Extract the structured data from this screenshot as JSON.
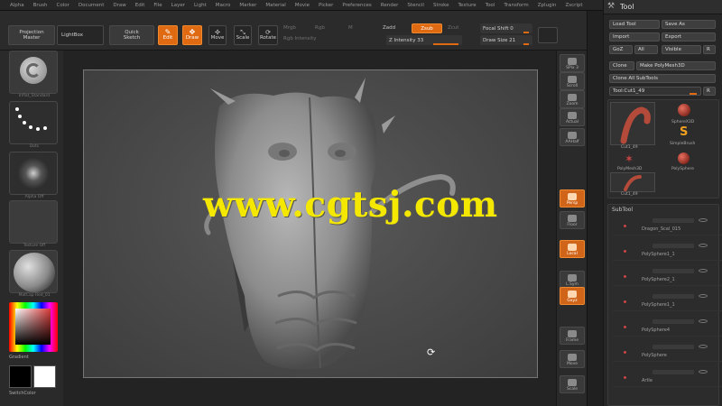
{
  "menu": [
    "Alpha",
    "Brush",
    "Color",
    "Document",
    "Draw",
    "Edit",
    "File",
    "Layer",
    "Light",
    "Macro",
    "Marker",
    "Material",
    "Movie",
    "Picker",
    "Preferences",
    "Render",
    "Stencil",
    "Stroke",
    "Texture",
    "Tool",
    "Transform",
    "Zplugin",
    "Zscript"
  ],
  "toolbar": {
    "projection_master": "Projection\nMaster",
    "lightbox": "LightBox",
    "quick_sketch": "Quick\nSketch",
    "edit": "Edit",
    "draw": "Draw",
    "move": "Move",
    "scale": "Scale",
    "rotate": "Rotate",
    "mrgb": "Mrgb",
    "rgb": "Rgb",
    "m": "M",
    "rgb_intensity": "Rgb Intensity",
    "zadd": "Zadd",
    "zsub": "Zsub",
    "zcut": "Zcut",
    "z_intensity": "Z Intensity 33",
    "focal_shift": "Focal Shift 0",
    "draw_size": "Draw Size 21"
  },
  "left_shelf": {
    "brush_caption": "Inflat_Standard",
    "stroke_caption": "Dots",
    "alpha_caption": "Alpha Off",
    "texture_caption": "Texture Off",
    "material_caption": "MatCap Red_01",
    "gradient": "Gradient",
    "switch_color": "SwitchColor"
  },
  "viewport": {
    "watermark": "www.cgtsj.com"
  },
  "right_shelf": [
    {
      "label": "SPix 3",
      "icon": "spix-icon"
    },
    {
      "label": "Scroll",
      "icon": "scroll-icon"
    },
    {
      "label": "Zoom",
      "icon": "zoom-icon"
    },
    {
      "label": "Actual",
      "icon": "actual-icon"
    },
    {
      "label": "AAHalf",
      "icon": "aahalf-icon"
    },
    {
      "label": "Persp",
      "icon": "persp-icon"
    },
    {
      "label": "Floor",
      "icon": "floor-icon"
    },
    {
      "label": "Local",
      "icon": "local-icon"
    },
    {
      "label": "L.Sym",
      "icon": "lsym-icon"
    },
    {
      "label": "Gxyz",
      "icon": "xyz-icon"
    },
    {
      "label": "Frame",
      "icon": "frame-icon"
    },
    {
      "label": "Move",
      "icon": "move-icon"
    },
    {
      "label": "Scale",
      "icon": "scale-icon"
    }
  ],
  "tool_palette": {
    "title": "Tool",
    "load_tool": "Load Tool",
    "save_as": "Save As",
    "import": "Import",
    "export": "Export",
    "goz": "GoZ",
    "all": "All",
    "visible": "Visible",
    "r": "R",
    "clone": "Clone",
    "make_polymesh": "Make PolyMesh3D",
    "clone_all_subtools": "Clone All SubTools",
    "tool_slider": "Tool:Cut1_49",
    "tools": [
      {
        "name": "Cut1_49"
      },
      {
        "name": "SphereX3D"
      },
      {
        "name": "SimpleBrush"
      },
      {
        "name": "PolyMesh3D"
      },
      {
        "name": "PolySphere"
      },
      {
        "name": "Cut1_49"
      }
    ],
    "subtool_header": "SubTool",
    "subtools": [
      "Dragon_Scal_015",
      "PolySphere1_1",
      "PolySphere2_1",
      "PolySphere1_1",
      "PolySphere4",
      "PolySphere",
      "Artle"
    ]
  },
  "colors": {
    "accent": "#e06a12",
    "watermark": "#f4e700"
  }
}
